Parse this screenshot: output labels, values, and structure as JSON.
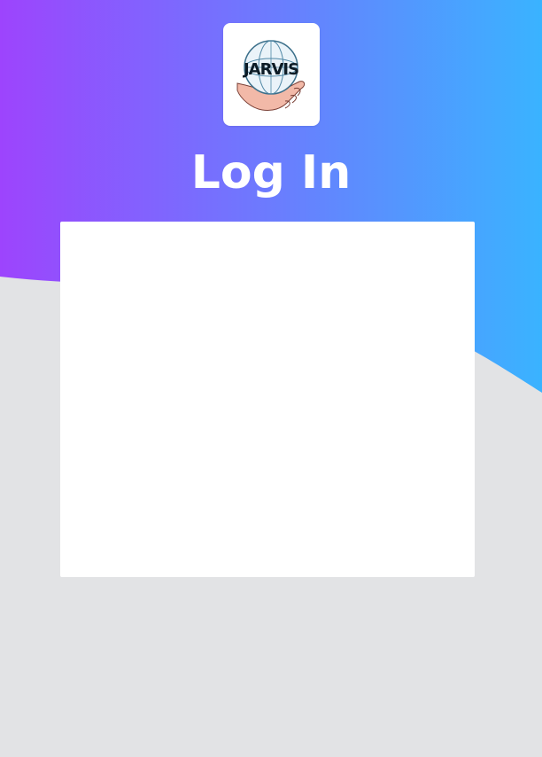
{
  "page": {
    "title": "Log In"
  },
  "logo": {
    "icon": "jarvis-globe-hand-logo",
    "text": "JARVIS"
  },
  "theme": {
    "gradient_start": "#9d44fd",
    "gradient_end": "#3ab3ff",
    "background": "#e2e3e5",
    "card": "#ffffff"
  }
}
